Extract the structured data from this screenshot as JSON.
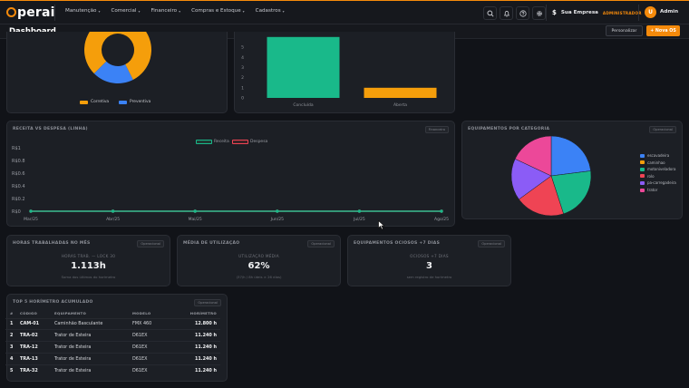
{
  "nav": {
    "logo": "perai",
    "menu": [
      {
        "label": "Manutenção"
      },
      {
        "label": "Comercial"
      },
      {
        "label": "Financeiro"
      },
      {
        "label": "Compras e Estoque"
      },
      {
        "label": "Cadastros"
      }
    ],
    "icons": [
      "search-icon",
      "bell-icon",
      "help-icon",
      "gear-icon"
    ],
    "company_symbol": "$",
    "company_name": "Sua Empresa",
    "company_role": "ADMINISTRADOR",
    "avatar_initial": "U",
    "user_name": "Admin"
  },
  "header": {
    "title": "Dashboard",
    "personalizar_label": "Personalizar",
    "nova_os_label": "+ Nova OS"
  },
  "colors": {
    "accent": "#f58a0b",
    "green": "#19b98a",
    "red": "#ef4454",
    "blue": "#3b82f6"
  },
  "donut_panel": {
    "legend": [
      {
        "label": "Corretiva",
        "color": "#f59e0b"
      },
      {
        "label": "Preventiva",
        "color": "#3b82f6"
      }
    ],
    "chart_data": {
      "type": "pie",
      "categories": [
        "Corretiva",
        "Preventiva"
      ],
      "values": [
        80,
        20
      ]
    }
  },
  "bar_panel": {
    "yticks": [
      "5",
      "4",
      "3",
      "2",
      "1",
      "0"
    ],
    "chart_data": {
      "type": "bar",
      "categories": [
        "Concluída",
        "Aberta"
      ],
      "values": [
        6,
        1
      ],
      "colors": [
        "#19b98a",
        "#f59e0b"
      ],
      "ylim": [
        0,
        5
      ]
    }
  },
  "line_panel": {
    "title": "RECEITA VS DESPESA (LINHA)",
    "tag": "Financeiro",
    "chart_data": {
      "type": "line",
      "categories": [
        "Mar/25",
        "Abr/25",
        "Mai/25",
        "Jun/25",
        "Jul/25",
        "Ago/25"
      ],
      "series": [
        {
          "name": "Receita",
          "values": [
            0,
            0,
            0,
            0,
            0,
            0
          ],
          "color": "#19b98a"
        },
        {
          "name": "Despesa",
          "values": [
            0,
            0,
            0,
            0,
            0,
            0
          ],
          "color": "#ef4454"
        }
      ],
      "yticks": [
        "R$1",
        "R$0.8",
        "R$0.6",
        "R$0.4",
        "R$0.2",
        "R$0"
      ],
      "ylim": [
        0,
        1
      ]
    }
  },
  "pie_panel": {
    "title": "EQUIPAMENTOS POR CATEGORIA",
    "tag": "Operacional",
    "chart_data": {
      "type": "pie",
      "categories": [
        "escavadeira",
        "caminhao",
        "motoniveladora",
        "rolo",
        "pa-carregadeira",
        "trator"
      ],
      "values": [
        23,
        0,
        22,
        20,
        17,
        18
      ],
      "colors": [
        "#3b82f6",
        "#f59e0b",
        "#19b98a",
        "#ef4454",
        "#8b5cf6",
        "#ec4899"
      ]
    }
  },
  "kpis": [
    {
      "title": "HORAS TRABALHADAS NO MÊS",
      "tag": "Operacional",
      "sub": "HORAS TRAB. — LOCK 30",
      "value": "1.113h",
      "note": "Soma dos últimos do horímetro"
    },
    {
      "title": "MÉDIA DE UTILIZAÇÃO",
      "tag": "Operacional",
      "sub": "UTILIZAÇÃO MÉDIA",
      "value": "62%",
      "note": "(37/h / 8h úteis × 26 dias)"
    },
    {
      "title": "EQUIPAMENTOS OCIOSOS +7 DIAS",
      "tag": "Operacional",
      "sub": "OCIOSOS +7 DIAS",
      "value": "3",
      "note": "sem registro de horímetro"
    }
  ],
  "table_panel": {
    "title": "TOP 5 HORÍMETRO ACUMULADO",
    "tag": "Operacional",
    "columns": [
      "#",
      "CÓDIGO",
      "EQUIPAMENTO",
      "MODELO",
      "HORÍMETRO"
    ],
    "rows": [
      {
        "rank": "1",
        "code": "CAM-01",
        "equip": "Caminhão Basculante",
        "model": "FMX 460",
        "hours": "12.800 h"
      },
      {
        "rank": "2",
        "code": "TRA-02",
        "equip": "Trator de Esteira",
        "model": "D61EX",
        "hours": "11.240 h"
      },
      {
        "rank": "3",
        "code": "TRA-12",
        "equip": "Trator de Esteira",
        "model": "D61EX",
        "hours": "11.240 h"
      },
      {
        "rank": "4",
        "code": "TRA-13",
        "equip": "Trator de Esteira",
        "model": "D61EX",
        "hours": "11.240 h"
      },
      {
        "rank": "5",
        "code": "TRA-32",
        "equip": "Trator de Esteira",
        "model": "D61EX",
        "hours": "11.240 h"
      }
    ]
  }
}
